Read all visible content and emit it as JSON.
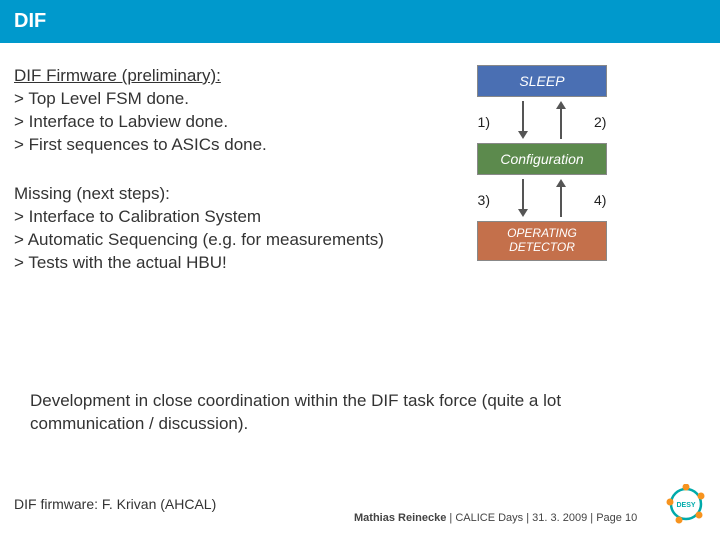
{
  "title": "DIF",
  "firmware_section": {
    "heading": "DIF Firmware (preliminary):",
    "items": [
      "Top Level FSM done.",
      "Interface to Labview done.",
      "First sequences to ASICs done."
    ]
  },
  "missing_section": {
    "heading": "Missing (next steps):",
    "items": [
      "Interface to Calibration System",
      "Automatic Sequencing (e.g. for measurements)",
      "Tests with the actual HBU!"
    ]
  },
  "diagram": {
    "states": {
      "sleep": "SLEEP",
      "configuration": "Configuration",
      "operating": "OPERATING DETECTOR"
    },
    "transitions": {
      "t1": "1)",
      "t2": "2)",
      "t3": "3)",
      "t4": "4)"
    }
  },
  "summary_text": "Development in close coordination within the DIF task force (quite a lot communication / discussion).",
  "footer": {
    "credit": "DIF firmware: F. Krivan (AHCAL)",
    "presenter": "Mathias Reinecke",
    "event": "CALICE Days",
    "date": "31. 3. 2009",
    "page_label": "Page 10"
  },
  "logo_name": "DESY"
}
